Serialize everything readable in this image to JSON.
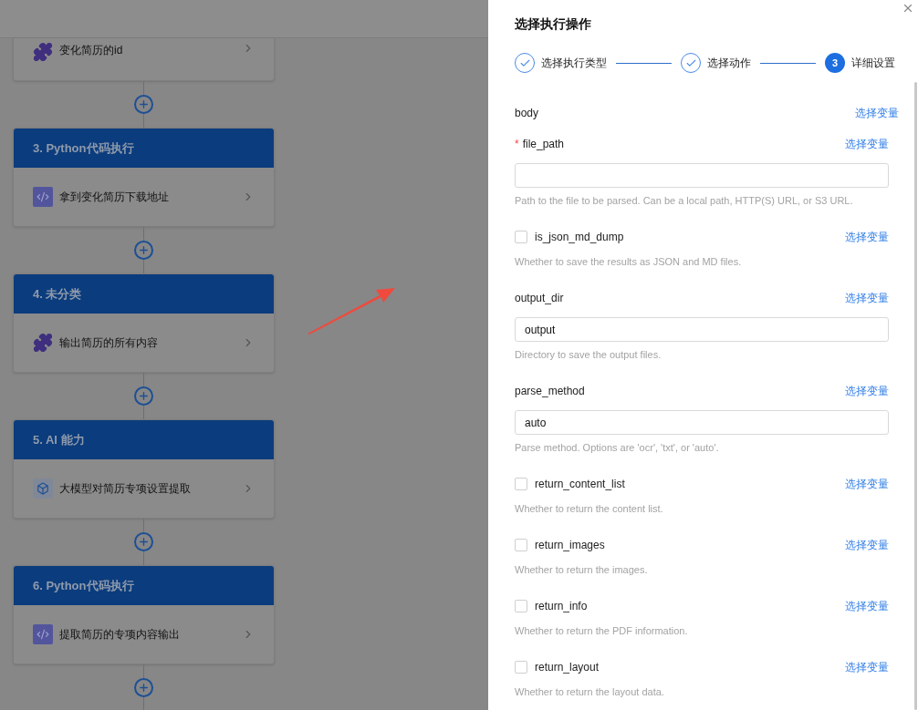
{
  "flow": {
    "cards": [
      {
        "item": {
          "kind": "plugin",
          "label": "变化简历的id"
        }
      },
      {
        "header": "3. Python代码执行",
        "item": {
          "kind": "code",
          "label": "拿到变化简历下载地址"
        }
      },
      {
        "header": "4. 未分类",
        "item": {
          "kind": "plugin",
          "label": "输出简历的所有内容"
        }
      },
      {
        "header": "5. AI 能力",
        "item": {
          "kind": "cube",
          "label": "大模型对简历专项设置提取"
        }
      },
      {
        "header": "6. Python代码执行",
        "item": {
          "kind": "code",
          "label": "提取简历的专项内容输出"
        }
      }
    ]
  },
  "drawer": {
    "title": "选择执行操作",
    "steps": [
      {
        "label": "选择执行类型",
        "completed": true
      },
      {
        "label": "选择动作",
        "completed": true
      },
      {
        "label": "详细设置",
        "completed": false,
        "number": "3"
      }
    ],
    "fields": [
      {
        "kind": "group",
        "label": "body",
        "link": "选择变量"
      },
      {
        "kind": "text",
        "required_mark": "*",
        "label": "file_path",
        "link": "选择变量",
        "description": "Path to the file to be parsed. Can be a local path, HTTP(S) URL, or S3 URL."
      },
      {
        "kind": "checkbox",
        "label": "is_json_md_dump",
        "checked": false,
        "link": "选择变量",
        "description": "Whether to save the results as JSON and MD files."
      },
      {
        "kind": "text",
        "label": "output_dir",
        "link": "选择变量",
        "value": "output",
        "description": "Directory to save the output files."
      },
      {
        "kind": "text",
        "label": "parse_method",
        "link": "选择变量",
        "value": "auto",
        "description": "Parse method. Options are 'ocr', 'txt', or 'auto'."
      },
      {
        "kind": "checkbox",
        "label": "return_content_list",
        "checked": false,
        "link": "选择变量",
        "description": "Whether to return the content list."
      },
      {
        "kind": "checkbox",
        "label": "return_images",
        "checked": false,
        "link": "选择变量",
        "description": "Whether to return the images."
      },
      {
        "kind": "checkbox",
        "label": "return_info",
        "checked": false,
        "link": "选择变量",
        "description": "Whether to return the PDF information."
      },
      {
        "kind": "checkbox",
        "label": "return_layout",
        "checked": false,
        "link": "选择变量",
        "description": "Whether to return the layout data."
      }
    ]
  }
}
